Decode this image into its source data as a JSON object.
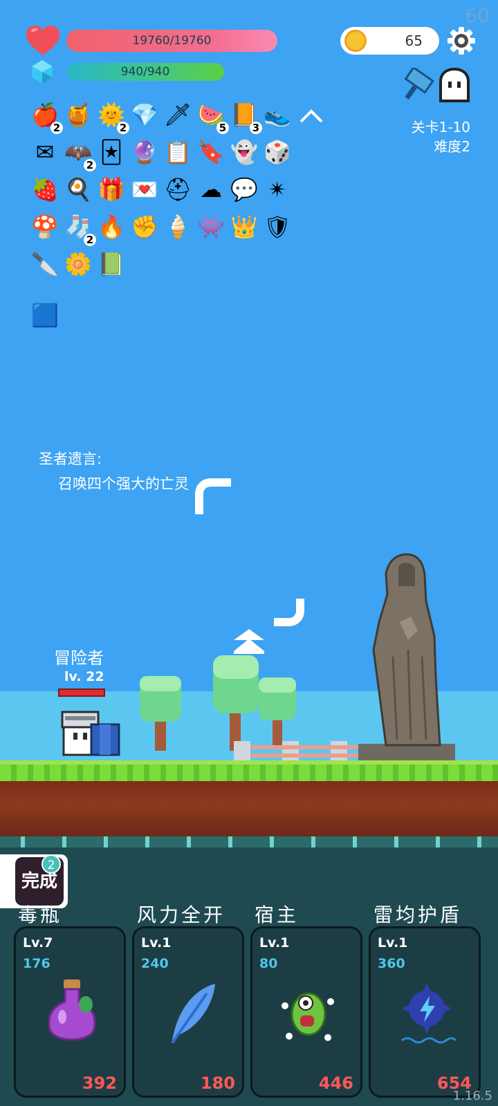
{
  "fps": "60",
  "hud": {
    "hp_text": "19760/19760",
    "mp_text": "940/940",
    "coins": "65",
    "hp_color": "#f0616c",
    "mp_color": "#3fc58e"
  },
  "stage": {
    "level": "关卡1-10",
    "difficulty": "难度2"
  },
  "items": [
    {
      "icon": "apple-icon",
      "glyph": "🍎",
      "count": "2"
    },
    {
      "icon": "jam-jar-icon",
      "glyph": "🍯",
      "count": ""
    },
    {
      "icon": "sun-icon",
      "glyph": "🌞",
      "count": "2"
    },
    {
      "icon": "diamond-icon",
      "glyph": "💎",
      "count": ""
    },
    {
      "icon": "sword-icon",
      "glyph": "🗡",
      "count": ""
    },
    {
      "icon": "watermelon-icon",
      "glyph": "🍉",
      "count": "5"
    },
    {
      "icon": "book-icon",
      "glyph": "📙",
      "count": "3"
    },
    {
      "icon": "sneaker-icon",
      "glyph": "👟",
      "count": ""
    },
    {
      "icon": "envelope-icon",
      "glyph": "✉",
      "count": ""
    },
    {
      "icon": "bat-icon",
      "glyph": "🦇",
      "count": "2"
    },
    {
      "icon": "cards-icon",
      "glyph": "🃏",
      "count": ""
    },
    {
      "icon": "crystal-ball-icon",
      "glyph": "🔮",
      "count": ""
    },
    {
      "icon": "clipboard-icon",
      "glyph": "📋",
      "count": ""
    },
    {
      "icon": "bookmark-icon",
      "glyph": "🔖",
      "count": ""
    },
    {
      "icon": "ghost-icon",
      "glyph": "👻",
      "count": ""
    },
    {
      "icon": "dice-icon",
      "glyph": "🎲",
      "count": ""
    },
    {
      "icon": "strawberry-icon",
      "glyph": "🍓",
      "count": ""
    },
    {
      "icon": "egg-icon",
      "glyph": "🍳",
      "count": ""
    },
    {
      "icon": "gift-icon",
      "glyph": "🎁",
      "count": ""
    },
    {
      "icon": "heart-letter-icon",
      "glyph": "💌",
      "count": ""
    },
    {
      "icon": "helmet-icon",
      "glyph": "⛑",
      "count": ""
    },
    {
      "icon": "cloud-icon",
      "glyph": "☁",
      "count": ""
    },
    {
      "icon": "speech-bubble-icon",
      "glyph": "💬",
      "count": ""
    },
    {
      "icon": "mace-icon",
      "glyph": "✴",
      "count": ""
    },
    {
      "icon": "mushroom-icon",
      "glyph": "🍄",
      "count": ""
    },
    {
      "icon": "sock-icon",
      "glyph": "🧦",
      "count": "2"
    },
    {
      "icon": "fire-icon",
      "glyph": "🔥",
      "count": ""
    },
    {
      "icon": "fist-icon",
      "glyph": "✊",
      "count": ""
    },
    {
      "icon": "ice-cream-icon",
      "glyph": "🍦",
      "count": ""
    },
    {
      "icon": "goblin-icon",
      "glyph": "👾",
      "count": ""
    },
    {
      "icon": "crown-icon",
      "glyph": "👑",
      "count": ""
    },
    {
      "icon": "shield-icon",
      "glyph": "🛡",
      "count": ""
    },
    {
      "icon": "dagger-icon",
      "glyph": "🔪",
      "count": ""
    },
    {
      "icon": "flower-icon",
      "glyph": "🌼",
      "count": ""
    },
    {
      "icon": "card-icon",
      "glyph": "📗",
      "count": ""
    },
    {
      "icon": "glowing-tile-icon",
      "glyph": "🟦",
      "count": ""
    }
  ],
  "story": {
    "title": "圣者遗言:",
    "line": "召唤四个强大的亡灵"
  },
  "hero": {
    "name": "冒险者",
    "level": "lv. 22"
  },
  "quest": {
    "label": "完成",
    "badge": "2"
  },
  "skills": [
    {
      "name": "毒瓶",
      "level": "Lv.7",
      "value": "176",
      "cost": "392",
      "icon": "poison-bottle-icon"
    },
    {
      "name": "风力全开",
      "level": "Lv.1",
      "value": "240",
      "cost": "180",
      "icon": "feather-icon"
    },
    {
      "name": "宿主",
      "level": "Lv.1",
      "value": "80",
      "cost": "446",
      "icon": "parasite-icon"
    },
    {
      "name": "雷均护盾",
      "level": "Lv.1",
      "value": "360",
      "cost": "654",
      "icon": "lightning-shield-icon"
    }
  ],
  "version": "1.16.5"
}
